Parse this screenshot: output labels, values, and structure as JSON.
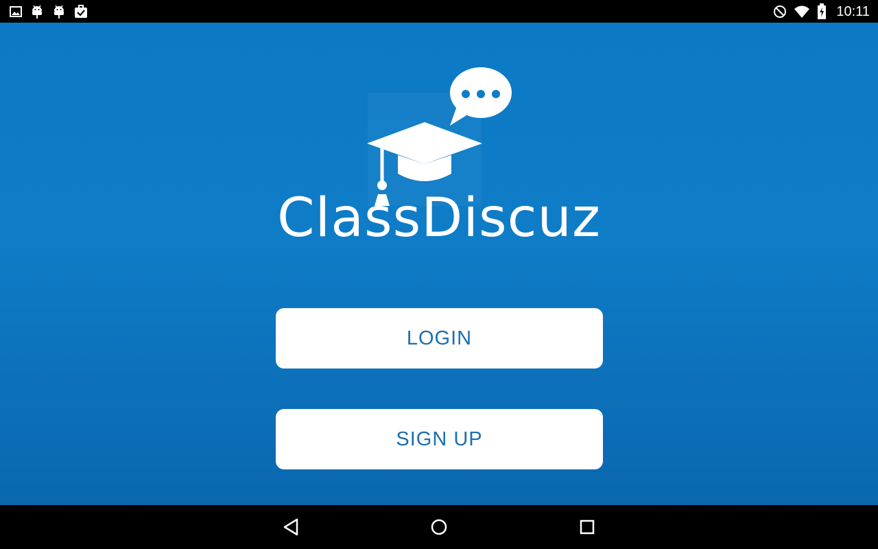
{
  "status_bar": {
    "time": "10:11",
    "left_icons": [
      "image-notification-icon",
      "android-debug-icon",
      "android-debug-icon",
      "task-check-icon"
    ],
    "right_icons": [
      "do-not-disturb-icon",
      "wifi-icon",
      "battery-charging-icon"
    ]
  },
  "app": {
    "name": "ClassDiscuz",
    "logo_icon": "graduation-cap-chat-icon",
    "brand_color": "#0e7cc7",
    "buttons": {
      "login_label": "LOGIN",
      "signup_label": "SIGN UP"
    }
  },
  "nav_bar": {
    "items": [
      "back-icon",
      "home-icon",
      "recents-icon"
    ]
  }
}
